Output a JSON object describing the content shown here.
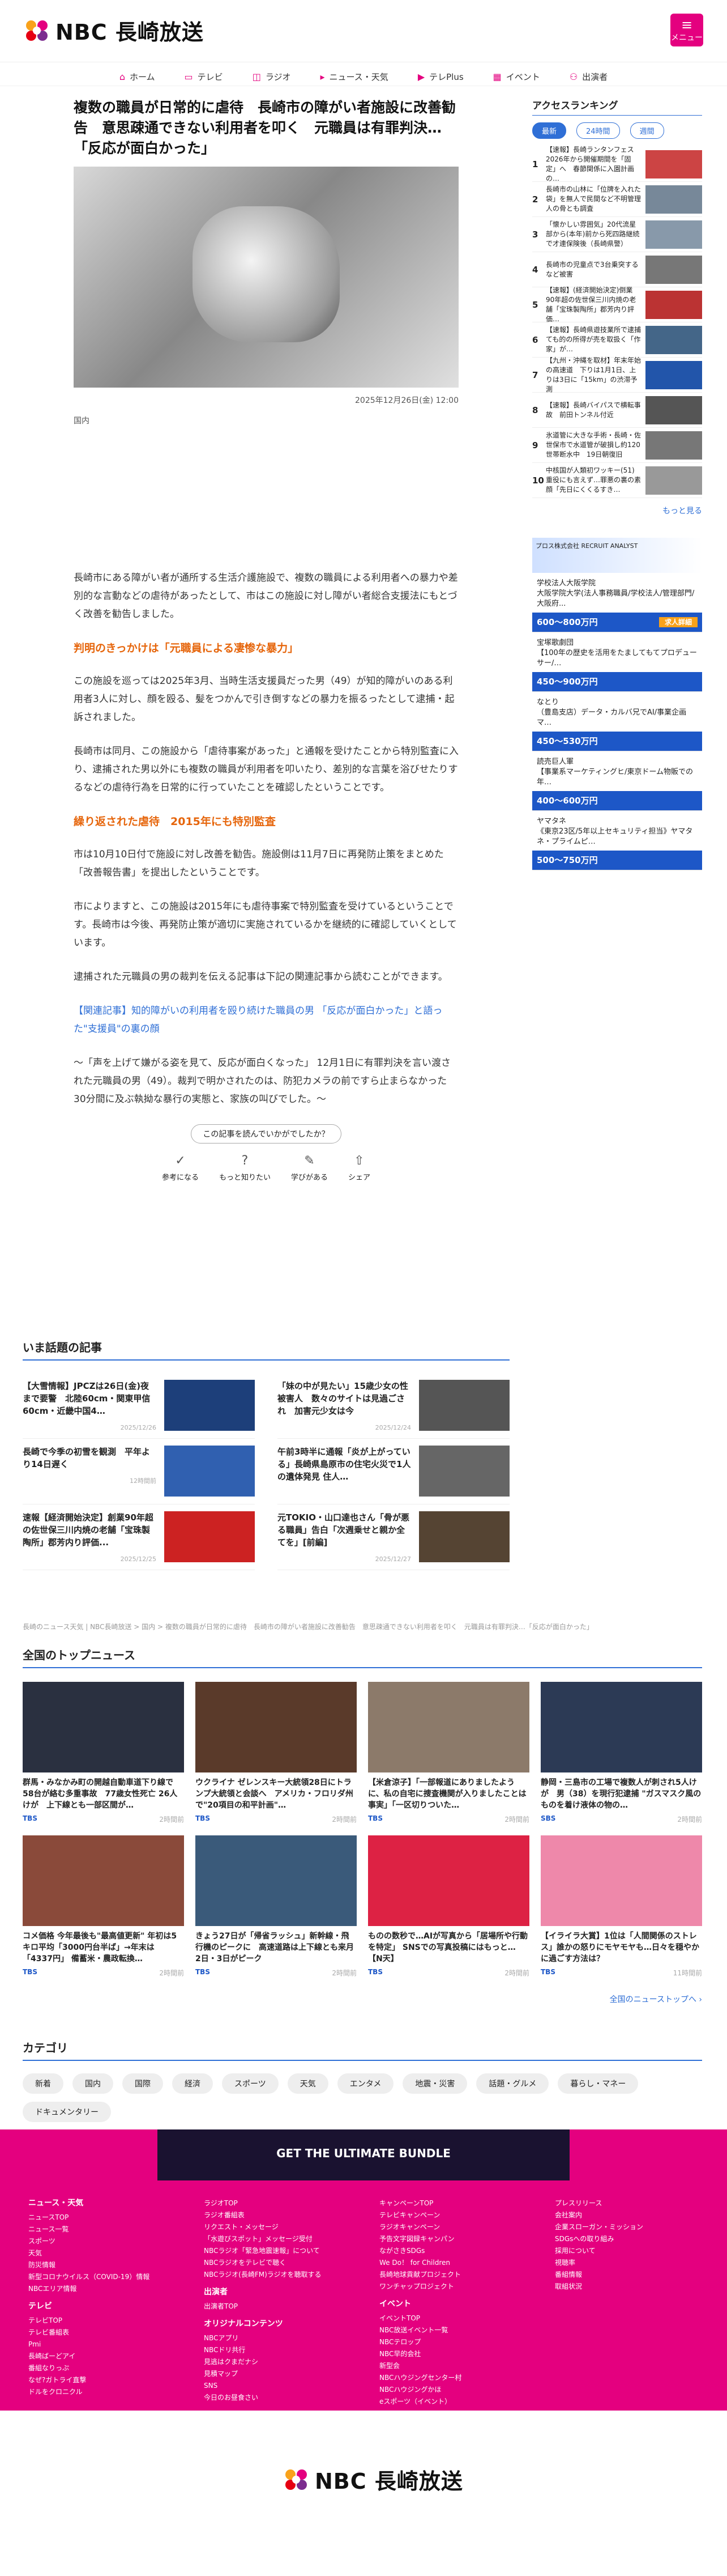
{
  "brand": {
    "name": "NBC 長崎放送",
    "menu_label": "メニュー"
  },
  "nav": [
    {
      "label": "ホーム",
      "icon": "home-icon",
      "glyph": "⌂"
    },
    {
      "label": "テレビ",
      "icon": "tv-icon",
      "glyph": "▭"
    },
    {
      "label": "ラジオ",
      "icon": "radio-icon",
      "glyph": "◫"
    },
    {
      "label": "ニュース・天気",
      "icon": "news-icon",
      "glyph": "▸"
    },
    {
      "label": "テレPlus",
      "icon": "play-icon",
      "glyph": "▶"
    },
    {
      "label": "イベント",
      "icon": "calendar-icon",
      "glyph": "▦"
    },
    {
      "label": "出演者",
      "icon": "people-icon",
      "glyph": "⚇"
    }
  ],
  "article": {
    "title": "複数の職員が日常的に虐待　長崎市の障がい者施設に改善勧告　意思疎通できない利用者を叩く　元職員は有罪判決…「反応が面白かった」",
    "date": "2025年12月26日(金) 12:00",
    "category": "国内",
    "p1": "長崎市にある障がい者が通所する生活介護施設で、複数の職員による利用者への暴力や差別的な言動などの虐待があったとして、市はこの施設に対し障がい者総合支援法にもとづく改善を勧告しました。",
    "h1": "判明のきっかけは「元職員による凄惨な暴力」",
    "p2": "この施設を巡っては2025年3月、当時生活支援員だった男（49）が知的障がいのある利用者3人に対し、顔を殴る、髪をつかんで引き倒すなどの暴力を振るったとして逮捕・起訴されました。",
    "p3": "長崎市は同月、この施設から「虐待事案があった」と通報を受けたことから特別監査に入り、逮捕された男以外にも複数の職員が利用者を叩いたり、差別的な言葉を浴びせたりするなどの虐待行為を日常的に行っていたことを確認したということです。",
    "h2": "繰り返された虐待　2015年にも特別監査",
    "p4": "市は10月10日付で施設に対し改善を勧告。施設側は11月7日に再発防止策をまとめた「改善報告書」を提出したということです。",
    "p5": "市によりますと、この施設は2015年にも虐待事案で特別監査を受けているということです。長崎市は今後、再発防止策が適切に実施されているかを継続的に確認していくとしています。",
    "p6": "逮捕された元職員の男の裁判を伝える記事は下記の関連記事から読むことができます。",
    "related": "【関連記事】知的障がいの利用者を殴り続けた職員の男 「反応が面白かった」と語った\"支援員\"の裏の顔",
    "p7": "〜「声を上げて嫌がる姿を見て、反応が面白くなった」 12月1日に有罪判決を言い渡された元職員の男（49）。裁判で明かされたのは、防犯カメラの前ですら止まらなかった30分間に及ぶ執拗な暴行の実態と、家族の叫びでした。〜",
    "rate_q": "この記事を読んでいかがでしたか？",
    "rate_btns": [
      {
        "label": "参考になる",
        "glyph": "✓"
      },
      {
        "label": "もっと知りたい",
        "glyph": "?"
      },
      {
        "label": "学びがある",
        "glyph": "✎"
      },
      {
        "label": "シェア",
        "glyph": "⇧"
      }
    ]
  },
  "ranking": {
    "title": "アクセスランキング",
    "tabs": [
      "最新",
      "24時間",
      "週間"
    ],
    "items": [
      {
        "no": "1",
        "text": "【速報】長崎ランタンフェス2026年から開催期間を「固定」へ　春節関係に入園計画の…",
        "color": "#c44"
      },
      {
        "no": "2",
        "text": "長崎市の山林に「位牌を入れた袋」を無人で民間など不明管理 人の骨とも調査",
        "color": "#789"
      },
      {
        "no": "3",
        "text": "「懐かしい雰囲気」20代流星部から(本年)前から死四路継続で才連保険後（長崎県警）",
        "color": "#8899aa"
      },
      {
        "no": "4",
        "text": "長崎市の児童点で3台乗突するなど被害",
        "color": "#777"
      },
      {
        "no": "5",
        "text": "【速報】(経済開始決定)倒業90年超の佐世保三川内焼の老舗「宝珠製陶所」郡芳内り評価…",
        "color": "#b33"
      },
      {
        "no": "6",
        "text": "【速報】長崎県遊技業所で逮捕ても的の所得が売を取扱く「作家」が…",
        "color": "#468"
      },
      {
        "no": "7",
        "text": "【九州・沖縄を取材】年末年始の高速道　下りは1月1日、上りは3日に「15km」の渋滞予測",
        "color": "#25a"
      },
      {
        "no": "8",
        "text": "【速報】長崎バイパスで横転事故　前田トンネル付近",
        "color": "#555"
      },
      {
        "no": "9",
        "text": "氷道管に大きな手術・長崎・佐世保市で水道管が破損し約120世帯断水中　19日朝復旧",
        "color": "#777"
      },
      {
        "no": "10",
        "text": "中核国が人類初ワッキー(51)重役にも言えず…罪悪の裏の素顔「先日にくくるすき…",
        "color": "#999"
      }
    ],
    "more": "もっと見る"
  },
  "jobs": {
    "ad": "プロス株式会社 RECRUIT ANALYST",
    "list": [
      {
        "name": "学校法人大阪学院",
        "desc": "大阪学院大学(法人事務職員/学校法人/管理部門/大阪府...",
        "pay": "600〜800万円",
        "tag": "求人詳細"
      },
      {
        "name": "宝塚歌劇団",
        "desc": "【100年の歴史を活用をたましてもてプロデューサー/…",
        "pay": "450〜900万円"
      },
      {
        "name": "なとり",
        "desc": "（豊島支店）データ・カルバ兄でAI/事業企画マ…",
        "pay": "450〜530万円"
      },
      {
        "name": "読売巨人軍",
        "desc": "【事業系マーケティングヒ/東京ドーム物販での年…",
        "pay": "400〜600万円"
      },
      {
        "name": "ヤマタネ",
        "desc": "《東京23区/5年以上セキュリティ担当》ヤマタネ・プライムピ…",
        "pay": "500〜750万円"
      }
    ]
  },
  "hot": {
    "title": "いま話題の記事",
    "items": [
      {
        "text": "【大雪情報】JPCZは26日(金)夜まで要警　北陸60cm・関東甲信60cm・近畿中国4…",
        "date": "2025/12/26",
        "color": "#1d3f7a"
      },
      {
        "text": "「妹の中が見たい」15歳少女の性被害人　数々のサイトは見過ごされ　加害元少女は今",
        "date": "2025/12/24",
        "color": "#555"
      },
      {
        "text": "長崎で今季の初雪を観測　平年より14日遅く",
        "date": "12時間前",
        "color": "#3060b0"
      },
      {
        "text": "午前3時半に通報「炎が上がっている」長崎県島原市の住宅火災で1人の遺体発見 住人…",
        "date": "",
        "color": "#666"
      },
      {
        "text": "速報【経済開始決定】創業90年超の佐世保三川内焼の老舗「宝珠製陶所」郡芳内り評価...",
        "date": "2025/12/25",
        "color": "#c22"
      },
      {
        "text": "元TOKIO・山口達也さん「骨が悪る職員」告白「次週乗せと親か全てを」[前編]",
        "date": "2025/12/27",
        "color": "#543"
      }
    ]
  },
  "breadcrumb": "長崎のニュース天気 | NBC長崎放送 > 国内 > 複数の職員が日常的に虐待　長崎市の障がい者施設に改善勧告　意思疎通できない利用者を叩く　元職員は有罪判決…「反応が面白かった」",
  "top": {
    "title": "全国のトップニュース",
    "items": [
      {
        "text": "群馬・みなかみ町の開越自動車道下り線で58台が絡む多重事故　77歳女性死亡 26人けが　上下線とも一部区間が…",
        "src": "TBS",
        "time": "2時間前",
        "color": "#2a3040"
      },
      {
        "text": "ウクライナ ゼレンスキー大統領28日にトランプ大統領と会談へ　アメリカ・フロリダ州で\"20項目の和平計画\"…",
        "src": "TBS",
        "time": "2時間前",
        "color": "#5a3a2a"
      },
      {
        "text": "【米倉涼子】「一部報道にありましたように、私の自宅に捜査機関が入りましたことは事実」「一区切りついた…",
        "src": "TBS",
        "time": "2時間前",
        "color": "#8c7a6a"
      },
      {
        "text": "静岡・三島市の工場で複数人が刺され5人けが　男（38）を現行犯逮捕 \"ガスマスク風のものを着け液体の物の…",
        "src": "SBS",
        "time": "2時間前",
        "color": "#2c3a55"
      },
      {
        "text": "コメ価格 今年最後も\"最高値更新\" 年初は5キロ平均「3000円台半ば」→年末は「4337円」 備蓄米・農政転換…",
        "src": "TBS",
        "time": "2時間前",
        "color": "#8a4a3a"
      },
      {
        "text": "きょう27日が「帰省ラッシュ」新幹線・飛行機のピークに　高速道路は上下線とも来月2日・3日がピーク",
        "src": "TBS",
        "time": "2時間前",
        "color": "#3a5a7a"
      },
      {
        "text": "ものの数秒で…AIが写真から「居場所や行動を特定」 SNSでの写真投稿にはもっと…【N天】",
        "src": "TBS",
        "time": "2時間前",
        "color": "#d24"
      },
      {
        "text": "【イライラ大賞】1位は「人間関係のストレス」誰かの怒りにモヤモヤも…日々を穏やかに過ごす方法は？",
        "src": "TBS",
        "time": "11時間前",
        "color": "#e8a"
      }
    ],
    "more": "全国のニューストップへ ›"
  },
  "categories": {
    "title": "カテゴリ",
    "tags": [
      "新着",
      "国内",
      "国際",
      "経済",
      "スポーツ",
      "天気",
      "エンタメ",
      "地震・災害",
      "話題・グルメ",
      "暮らし・マネー",
      "ドキュメンタリー"
    ]
  },
  "footer": {
    "banner": "GET THE ULTIMATE BUNDLE",
    "col1": {
      "head": "ニュース・天気",
      "items": [
        "ニュースTOP",
        "ニュース一覧",
        "スポーツ",
        "天気",
        "防災情報",
        "新型コロナウイルス（COVID-19）情報",
        "NBCエリア情報"
      ],
      "head2": "テレビ",
      "items2": [
        "テレビTOP",
        "テレビ番組表",
        "Pmi",
        "長崎ばーどアイ",
        "番組なりっぷ",
        "なぜ?ガトライ直撃",
        "ドルをクロニクル"
      ]
    },
    "col2": {
      "items": [
        "ラジオTOP",
        "ラジオ番組表",
        "リクエスト・メッセージ",
        "「水遊びスポット」メッセージ受付",
        "NBCラジオ「緊急地震速報」について",
        "NBCラジオをテレビで聴く",
        "NBCラジオ(長崎FM)ラジオを聴取する"
      ],
      "head2": "出演者",
      "items2": [
        "出演者TOP"
      ],
      "head3": "オリジナルコンテンツ",
      "items3": [
        "NBCアプリ",
        "NBCドリ共行",
        "見逃はクまだナシ",
        "見積マップ",
        "SNS",
        "今日のお昼食さい"
      ]
    },
    "col3": {
      "items": [
        "キャンペーンTOP",
        "テレビキャンペーン",
        "ラジオキャンペーン",
        "予告文字図録キャンパン",
        "ながさきSDGs",
        "We Do！ for Children",
        "長崎地球貢献プロジェクト",
        "ワンチャップロジェクト"
      ],
      "head2": "イベント",
      "items2": [
        "イベントTOP",
        "NBC放送イベント一覧",
        "NBCテロップ",
        "NBC早的会社",
        "新型会",
        "NBCハウジングセンター村",
        "NBCハウジングかほ",
        "eスポーツ（イベント）"
      ]
    },
    "col4": {
      "items": [
        "プレスリリース",
        "会社案内",
        "企業スローガン・ミッション",
        "SDGsへの取り組み",
        "採用について",
        "視聴率",
        "番組情報",
        "取組状況"
      ]
    }
  },
  "colors": {
    "accent": "#e4007f",
    "link": "#2f6fd6",
    "heading": "#e6650b",
    "job": "#1d57c7"
  }
}
